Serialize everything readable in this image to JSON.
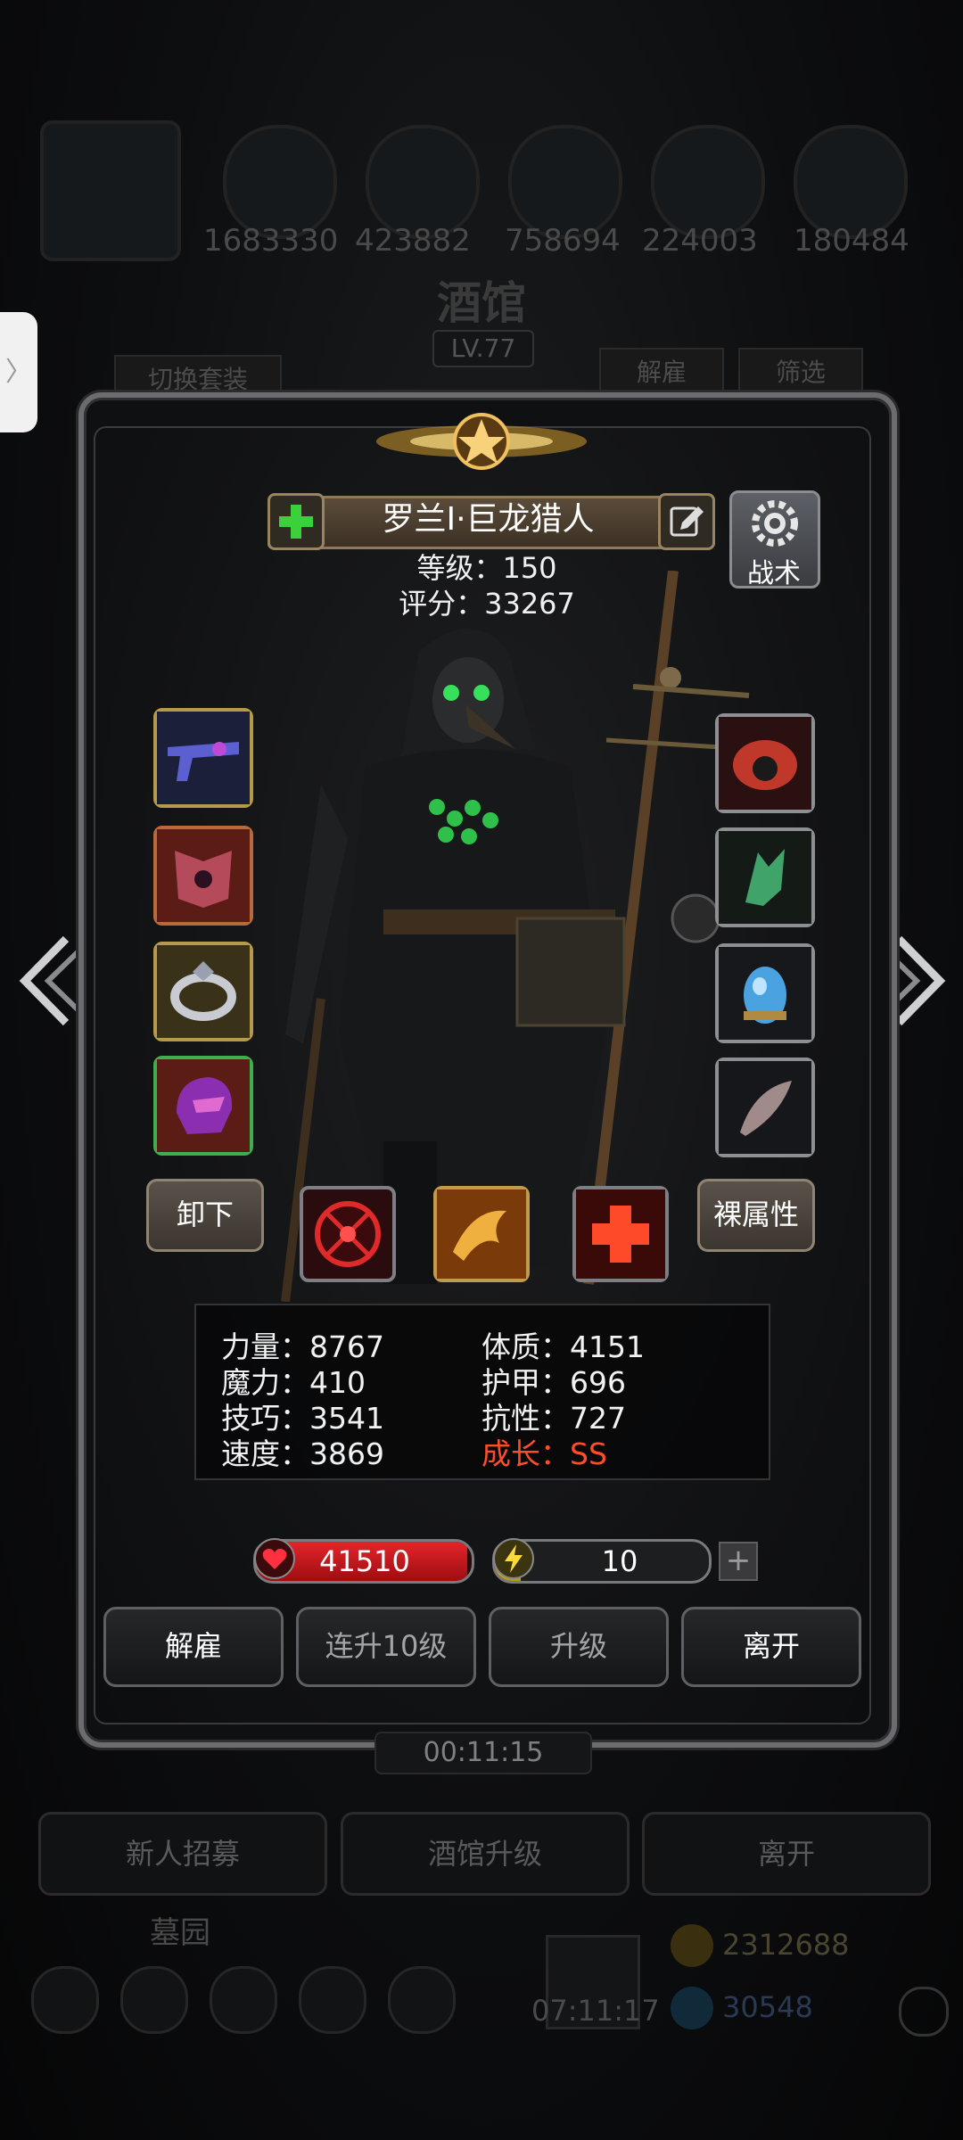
{
  "background": {
    "resources": [
      "1683330",
      "423882",
      "758694",
      "224003",
      "180484"
    ],
    "title": "酒馆",
    "level_badge": "LV.77",
    "switch_outfit": "切换套装",
    "dismiss": "解雇",
    "filter": "筛选",
    "recruit": "新人招募",
    "tavern_upgrade": "酒馆升级",
    "leave": "离开",
    "cemetery": "墓园",
    "gold": "2312688",
    "gems": "30548",
    "clock": "07:11:17"
  },
  "hero": {
    "name": "罗兰Ⅰ·巨龙猎人",
    "level_text": "等级：150",
    "score_text": "评分：33267",
    "tactics_label": "战术",
    "unequip_label": "卸下",
    "bare_attr_label": "裸属性"
  },
  "stats": {
    "strength": "力量：8767",
    "magic": "魔力：410",
    "skill": "技巧：3541",
    "speed": "速度：3869",
    "constitution": "体质：4151",
    "armor": "护甲：696",
    "resistance": "抗性：727",
    "growth": "成长：SS"
  },
  "bars": {
    "hp": "41510",
    "hp_fill": 0.98,
    "energy": "10",
    "energy_fill": 0.12
  },
  "actions": {
    "dismiss": "解雇",
    "level_up_10": "连升10级",
    "level_up": "升级",
    "leave": "离开"
  },
  "timer": "00:11:15",
  "colors": {
    "growth": "#ff4d2a",
    "hp": "#d81e24",
    "energy": "#f2de3a",
    "frame": "#6c6c70"
  }
}
